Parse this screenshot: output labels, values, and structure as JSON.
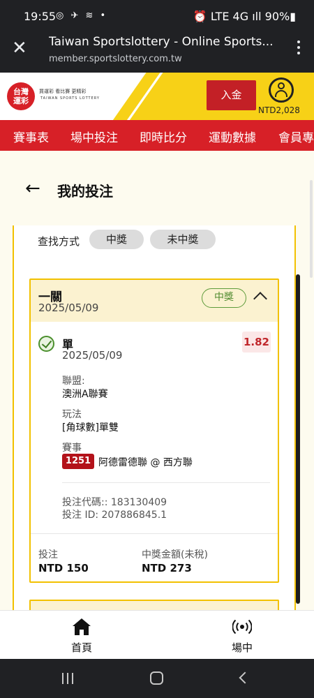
{
  "status_bar": {
    "time": "19:55",
    "left_icons": "◎ ✈ ≋ •",
    "right_text": "⏰ LTE 4G ıll 90%▮"
  },
  "browser": {
    "title": "Taiwan Sportslottery - Online Sports...",
    "url": "member.sportslottery.com.tw",
    "close_icon": "close-icon",
    "menu_icon": "more-vertical-icon"
  },
  "site_header": {
    "logo_line1": "台灣",
    "logo_line2": "運彩",
    "logo_tagline": "買運彩  看比賽  更精彩",
    "logo_english": "TAIWAN SPORTS LOTTERY",
    "deposit_label": "入金",
    "balance": "NTD2,028",
    "accent": "#d72027",
    "stripe_color": "#f7d117"
  },
  "nav": {
    "items": [
      "賽事表",
      "場中投注",
      "即時比分",
      "運動數據",
      "會員專"
    ]
  },
  "page": {
    "title": "我的投注",
    "back_icon": "arrow-left-icon"
  },
  "filter": {
    "label": "查找方式",
    "options": [
      "中獎",
      "未中獎"
    ]
  },
  "bet_card": {
    "title": "一關",
    "date": "2025/05/09",
    "status": "中獎",
    "selection": {
      "type": "單",
      "date": "2025/05/09",
      "odds": "1.82",
      "league_label": "聯盟:",
      "league": "澳洲A聯賽",
      "market_label": "玩法",
      "market": "[角球數]單雙",
      "event_label": "賽事",
      "match_no": "1251",
      "match_name": "阿德雷德聯 @ 西方聯"
    },
    "bet_code": "投注代碼:: 183130409",
    "bet_id": "投注 ID: 207886845.1",
    "stake_label": "投注",
    "stake": "NTD 150",
    "payout_label": "中獎金額(未稅)",
    "payout": "NTD 273"
  },
  "bottom_nav": {
    "items": [
      {
        "label": "首頁",
        "icon": "home-icon"
      },
      {
        "label": "場中",
        "icon": "live-broadcast-icon"
      }
    ]
  }
}
